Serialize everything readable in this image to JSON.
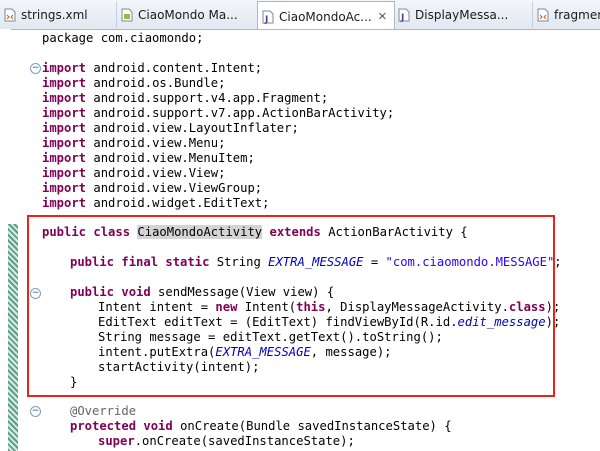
{
  "tabs": [
    {
      "label": "strings.xml",
      "active": false,
      "icon": "xml-file-icon"
    },
    {
      "label": "CiaoMondo Ma...",
      "active": false,
      "icon": "manifest-file-icon"
    },
    {
      "label": "CiaoMondoAc...",
      "active": true,
      "icon": "java-file-icon",
      "close": "✕"
    },
    {
      "label": "DisplayMessa...",
      "active": false,
      "icon": "java-file-icon"
    },
    {
      "label": "fragment_",
      "active": false,
      "icon": "xml-file-icon"
    }
  ],
  "code": {
    "package": "package com.ciaomondo;",
    "imports": [
      "android.content.Intent;",
      "android.os.Bundle;",
      "android.support.v4.app.Fragment;",
      "android.support.v7.app.ActionBarActivity;",
      "android.view.LayoutInflater;",
      "android.view.Menu;",
      "android.view.MenuItem;",
      "android.view.View;",
      "android.view.ViewGroup;",
      "android.widget.EditText;"
    ],
    "class_decl": {
      "mods": "public class",
      "name": "CiaoMondoActivity",
      "extends_kw": "extends",
      "rest": " ActionBarActivity {"
    },
    "field": {
      "mods": "public final static",
      "rest1": " String ",
      "name": "EXTRA_MESSAGE",
      "rest2": " = ",
      "value": "\"com.ciaomondo.MESSAGE\"",
      "end": ";"
    },
    "method_decl": {
      "mods": "public void",
      "rest": " sendMessage(View view) {"
    },
    "body": {
      "l1a": "Intent intent = ",
      "l1kw": "new",
      "l1b": " Intent(",
      "l1kw2": "this",
      "l1c": ", DisplayMessageActivity.",
      "l1kw3": "class",
      "l1d": ");",
      "l2a": "EditText editText = (EditText) findViewById(R.id.",
      "l2fld": "edit_message",
      "l2b": ");",
      "l3": "String message = editText.getText().toString();",
      "l4a": "intent.putExtra(",
      "l4fld": "EXTRA_MESSAGE",
      "l4b": ", message);",
      "l5": "startActivity(intent);",
      "close": "}"
    },
    "override": "@Override",
    "oncreate": {
      "mods": "protected void",
      "rest": " onCreate(Bundle savedInstanceState) {"
    },
    "super_line": {
      "kw": "super",
      "rest": ".onCreate(savedInstanceState);"
    }
  },
  "colors": {
    "keyword": "#7f0055",
    "string": "#2a00ff",
    "field": "#0000c0",
    "highlight_box": "#e8251a"
  }
}
